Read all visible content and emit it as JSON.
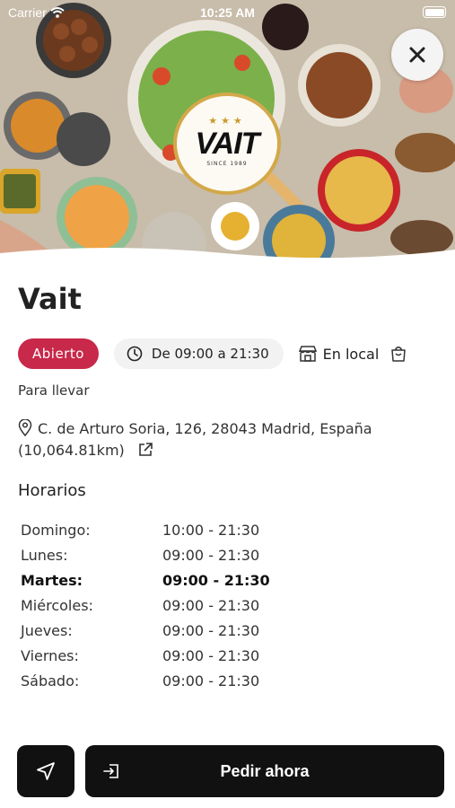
{
  "status_bar": {
    "carrier": "Carrier",
    "time": "10:25 AM"
  },
  "hero": {
    "logo": {
      "stars": "★★★",
      "wordmark": "VAIT",
      "since": "SINCE 1989"
    }
  },
  "restaurant": {
    "name": "Vait",
    "status_label": "Abierto",
    "hours_label": "De 09:00 a 21:30",
    "service_local": "En local",
    "service_takeaway": "Para llevar",
    "address": "C. de Arturo Soria, 126, 28043 Madrid, España",
    "distance": "(10,064.81km)"
  },
  "schedule": {
    "title": "Horarios",
    "days": [
      {
        "day": "Domingo:",
        "hours": "10:00 - 21:30"
      },
      {
        "day": "Lunes:",
        "hours": "09:00 - 21:30"
      },
      {
        "day": "Martes:",
        "hours": "09:00 - 21:30"
      },
      {
        "day": "Miércoles:",
        "hours": "09:00 - 21:30"
      },
      {
        "day": "Jueves:",
        "hours": "09:00 - 21:30"
      },
      {
        "day": "Viernes:",
        "hours": "09:00 - 21:30"
      },
      {
        "day": "Sábado:",
        "hours": "09:00 - 21:30"
      }
    ]
  },
  "actions": {
    "order_label": "Pedir ahora"
  },
  "colors": {
    "open_chip": "#c8284a",
    "button": "#111111",
    "chip_bg": "#f2f2f2"
  },
  "icons": {
    "close": "close-icon",
    "clock": "clock-icon",
    "store": "store-icon",
    "bag": "shopping-bag-icon",
    "pin": "location-pin-icon",
    "external": "external-link-icon",
    "navigate": "navigation-arrow-icon",
    "login": "login-icon"
  }
}
